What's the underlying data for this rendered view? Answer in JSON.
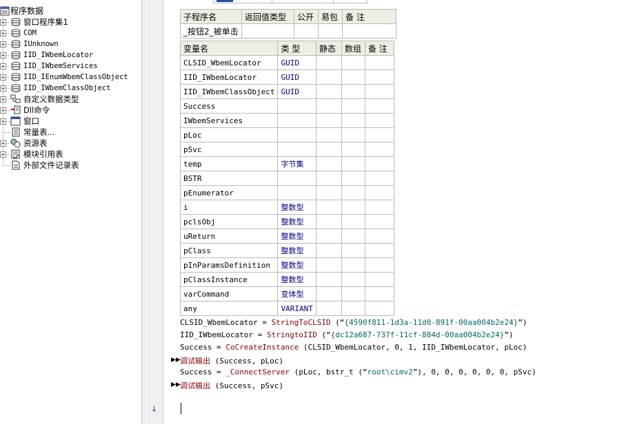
{
  "tree": {
    "root": "程序数据",
    "items": [
      {
        "label": "窗口程序集1",
        "icon": "class-module-icon",
        "expandable": true
      },
      {
        "label": "COM",
        "icon": "class-module-icon",
        "expandable": true
      },
      {
        "label": "IUnknown",
        "icon": "class-module-icon",
        "expandable": true
      },
      {
        "label": "IID_IWbemLocator",
        "icon": "class-module-icon",
        "expandable": true
      },
      {
        "label": "IID_IWbemServices",
        "icon": "class-module-icon",
        "expandable": true
      },
      {
        "label": "IID_IEnumWbemClassObject",
        "icon": "class-module-icon",
        "expandable": true
      },
      {
        "label": "IID_IWbemClassObject",
        "icon": "class-module-icon",
        "expandable": true
      },
      {
        "label": "自定义数据类型",
        "icon": "data-type-icon",
        "expandable": true
      },
      {
        "label": "Dll命令",
        "icon": "dll-command-icon",
        "expandable": true
      },
      {
        "label": "窗口",
        "icon": "window-icon",
        "expandable": true
      },
      {
        "label": "常量表...",
        "icon": "constant-table-icon",
        "expandable": false
      },
      {
        "label": "资源表",
        "icon": "resource-table-icon",
        "expandable": true
      },
      {
        "label": "模块引用表",
        "icon": "module-reference-icon",
        "expandable": true
      },
      {
        "label": "外部文件记录表",
        "icon": "external-file-icon",
        "expandable": false
      }
    ]
  },
  "sub_header": {
    "columns": [
      "子程序名",
      "返回值类型",
      "公开",
      "易包",
      "备 注"
    ],
    "row": {
      "name": "_按钮2_被单击",
      "return_type": "",
      "public": "",
      "easy_pkg": "",
      "note": ""
    }
  },
  "variables": {
    "columns": [
      "变量名",
      "类 型",
      "静态",
      "数组",
      "备 注"
    ],
    "rows": [
      {
        "name": "CLSID_WbemLocator",
        "type": "GUID"
      },
      {
        "name": "IID_IWbemLocator",
        "type": "GUID"
      },
      {
        "name": "IID_IWbemClassObject",
        "type": "GUID"
      },
      {
        "name": "Success",
        "type": ""
      },
      {
        "name": "IWbemServices",
        "type": ""
      },
      {
        "name": "pLoc",
        "type": ""
      },
      {
        "name": "pSvc",
        "type": ""
      },
      {
        "name": "temp",
        "type": "字节集"
      },
      {
        "name": "BSTR",
        "type": ""
      },
      {
        "name": "pEnumerator",
        "type": ""
      },
      {
        "name": "i",
        "type": "整数型"
      },
      {
        "name": "pclsObj",
        "type": "整数型"
      },
      {
        "name": "uReturn",
        "type": "整数型"
      },
      {
        "name": "pClass",
        "type": "整数型"
      },
      {
        "name": "pInParamsDefinition",
        "type": "整数型"
      },
      {
        "name": "pClassInstance",
        "type": "整数型"
      },
      {
        "name": "varCommand",
        "type": "变体型"
      },
      {
        "name": "any",
        "type": "VARIANT"
      }
    ]
  },
  "code": {
    "line1": {
      "lhs": "CLSID_WbemLocator = ",
      "fn": "StringToCLSID",
      "open": " (“",
      "str": "{4590f811-1d3a-11d0-891f-00aa004b2e24}",
      "close": "”)"
    },
    "line2": {
      "lhs": "IID_IWbemLocator = ",
      "fn": "StringtoIID",
      "open": " (“",
      "str": "{dc12a687-737f-11cf-884d-00aa004b2e24}",
      "close": "”)"
    },
    "line3": {
      "lhs": "Success = ",
      "fn": "CoCreateInstance",
      "args": " (CLSID_WbemLocator, 0, 1, IID_IWbemLocator, pLoc)"
    },
    "line4": {
      "fn": "调试输出",
      "args": " (Success, pLoc)"
    },
    "line5": {
      "lhs": "Success = ",
      "fn": "_ConnectServer",
      "args_a": " (pLoc, bstr_t (“",
      "str": "root\\cimv2",
      "args_b": "”), 0, 0, 0, 0, 0, 0, pSvc)"
    },
    "line6": {
      "fn": "调试输出",
      "args": " (Success, pSvc)"
    }
  }
}
